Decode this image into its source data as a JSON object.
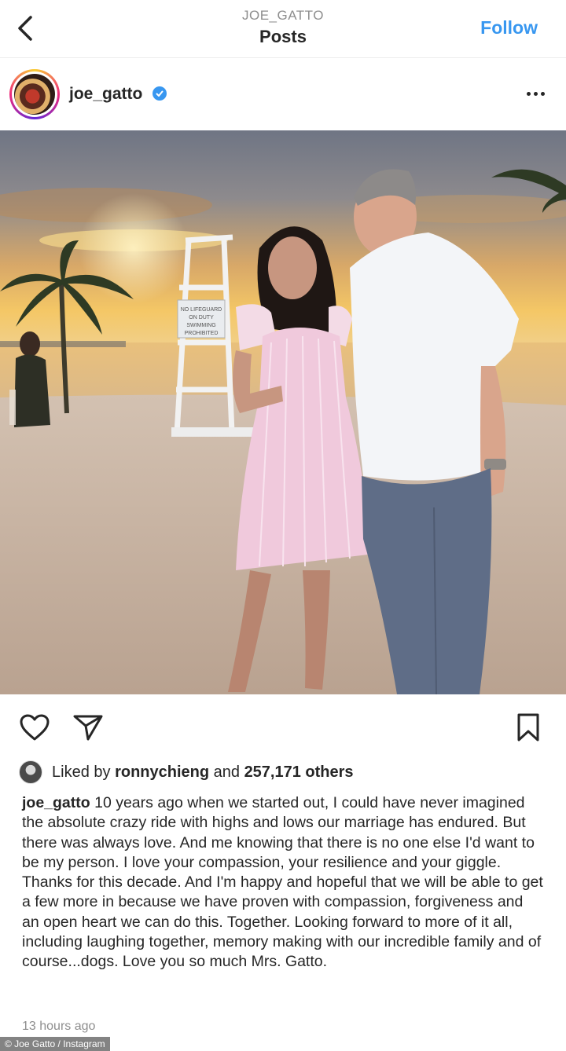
{
  "nav": {
    "username": "JOE_GATTO",
    "title": "Posts",
    "follow_label": "Follow"
  },
  "post": {
    "username": "joe_gatto",
    "verified": true,
    "photo": {
      "sign_text": [
        "NO LIFEGUARD",
        "ON DUTY",
        "SWIMMING",
        "PROHIBITED"
      ]
    }
  },
  "likes": {
    "prefix": "Liked by ",
    "liker": "ronnychieng",
    "middle": " and ",
    "others": "257,171 others"
  },
  "caption": {
    "username": "joe_gatto",
    "text": " 10 years ago when we started out, I could have never imagined the absolute crazy ride with highs and lows our marriage has endured. But there was always love. And me knowing that there is no one else I'd want to be my person. I love your compassion, your resilience and your giggle. Thanks for this decade. And I'm happy and hopeful that we will be able to get a few more in because we have proven with compassion, forgiveness and an open heart we can do this. Together. Looking forward to more of it all, including laughing together, memory making with our incredible family and of course...dogs. Love you so much Mrs. Gatto."
  },
  "timestamp": "13 hours ago",
  "credit": "© Joe Gatto / Instagram",
  "colors": {
    "accent": "#3897f0",
    "text": "#262626",
    "muted": "#8e8e8e"
  },
  "icons": [
    "back-arrow-icon",
    "verified-badge-icon",
    "more-options-icon",
    "heart-icon",
    "share-icon",
    "bookmark-icon"
  ]
}
